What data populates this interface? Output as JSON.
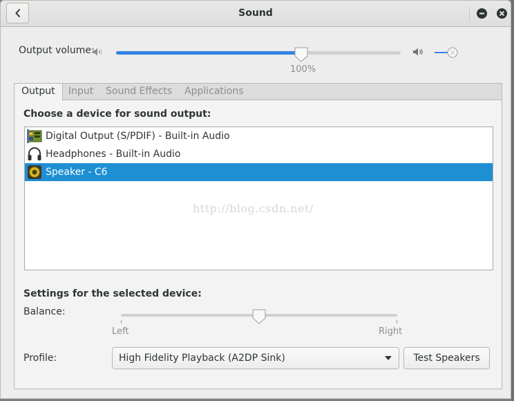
{
  "window": {
    "title": "Sound"
  },
  "volume": {
    "label": "Output volume:",
    "level": 0.65,
    "percent_label": "100%",
    "low_icon": "speaker-low-icon",
    "high_icon": "speaker-high-icon"
  },
  "tabs": [
    {
      "label": "Output",
      "active": true
    },
    {
      "label": "Input",
      "active": false
    },
    {
      "label": "Sound Effects",
      "active": false
    },
    {
      "label": "Applications",
      "active": false
    }
  ],
  "output": {
    "heading": "Choose a device for sound output:",
    "devices": [
      {
        "label": "Digital Output (S/PDIF) - Built-in Audio",
        "icon": "audio-card-icon",
        "selected": false
      },
      {
        "label": "Headphones - Built-in Audio",
        "icon": "headphones-icon",
        "selected": false
      },
      {
        "label": "Speaker - C6",
        "icon": "speaker-icon",
        "selected": true
      }
    ],
    "watermark": "http://blog.csdn.net/",
    "settings_heading": "Settings for the selected device:",
    "balance_label": "Balance:",
    "balance_value": 0.5,
    "balance_left": "Left",
    "balance_right": "Right",
    "profile_label": "Profile:",
    "profile_value": "High Fidelity Playback (A2DP Sink)",
    "test_button": "Test Speakers"
  },
  "colors": {
    "accent": "#3584e4",
    "selection": "#1f8fd4"
  }
}
